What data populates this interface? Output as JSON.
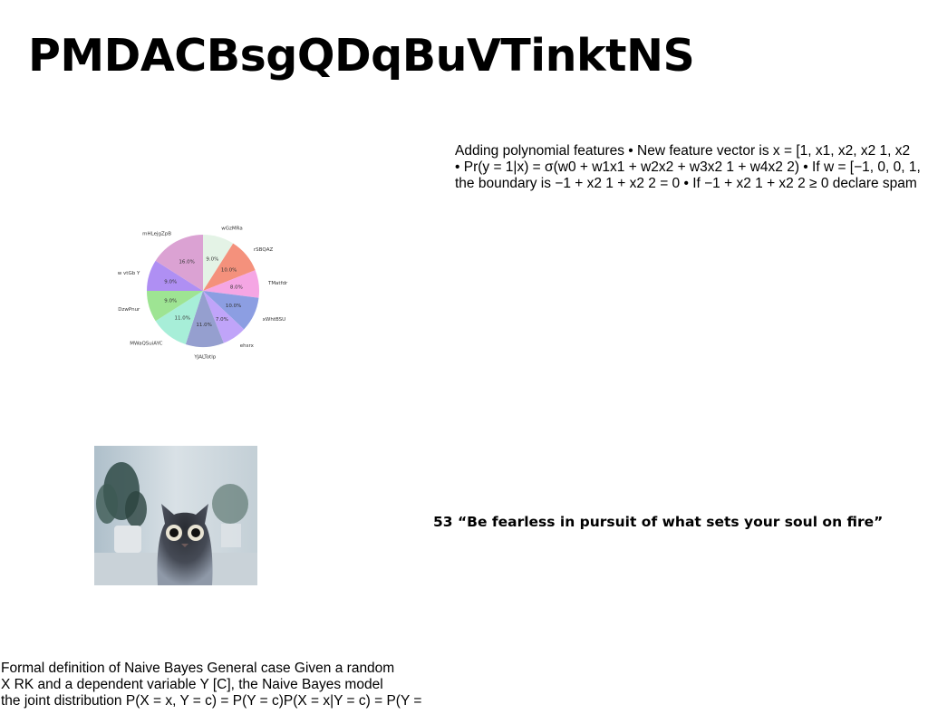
{
  "title": "PMDACBsgQDqBuVTinktNS",
  "top_paragraph": {
    "lines": [
      "Adding polynomial features • New feature vector is x = [1, x1, x2, x2 1, x2",
      "• Pr(y = 1|x) = σ(w0 + w1x1 + w2x2 + w3x2 1 + w4x2 2) • If w = [−1, 0, 0, 1,",
      "the boundary is −1 + x2 1 + x2 2 = 0 • If −1 + x2 1 + x2 2 ≥ 0 declare spam"
    ]
  },
  "chart_data": {
    "type": "pie",
    "start_angle_deg": 90,
    "direction": "clockwise",
    "slices": [
      {
        "label": "wGzMRa",
        "value": 9.0,
        "pct_label": "9.0%",
        "color": "#e4f3e6"
      },
      {
        "label": "rSBQAZ",
        "value": 10.0,
        "pct_label": "10.0%",
        "color": "#f4917c"
      },
      {
        "label": "TMatfdr",
        "value": 8.0,
        "pct_label": "8.0%",
        "color": "#f5a6e4"
      },
      {
        "label": "xWhtBSU",
        "value": 10.0,
        "pct_label": "10.0%",
        "color": "#8c9ee2"
      },
      {
        "label": "ehsrx",
        "value": 7.0,
        "pct_label": "7.0%",
        "color": "#c0a4f9"
      },
      {
        "label": "YJALTotlp",
        "value": 11.0,
        "pct_label": "11.0%",
        "color": "#959fcf"
      },
      {
        "label": "MWaQSuiAYC",
        "value": 11.0,
        "pct_label": "11.0%",
        "color": "#a7eed8"
      },
      {
        "label": "DzwPnur",
        "value": 9.0,
        "pct_label": "9.0%",
        "color": "#9ee493"
      },
      {
        "label": "w vtGb Y",
        "value": 9.0,
        "pct_label": "9.0%",
        "color": "#af8ff3"
      },
      {
        "label": "mHLejgZpB",
        "value": 16.0,
        "pct_label": "16.0%",
        "color": "#dba2d3"
      }
    ]
  },
  "photo": {
    "subject": "black and grey cat with wide eyes in front of potted plants"
  },
  "quote": "53 “Be fearless in pursuit of what sets your soul on fire”",
  "bottom_paragraph": {
    "lines": [
      "Formal definition of Naive Bayes General case Given a random",
      "X  RK and a dependent variable Y  [C], the Naive Bayes model",
      "the joint distribution P(X = x, Y = c) = P(Y = c)P(X = x|Y = c) = P(Y ="
    ]
  }
}
